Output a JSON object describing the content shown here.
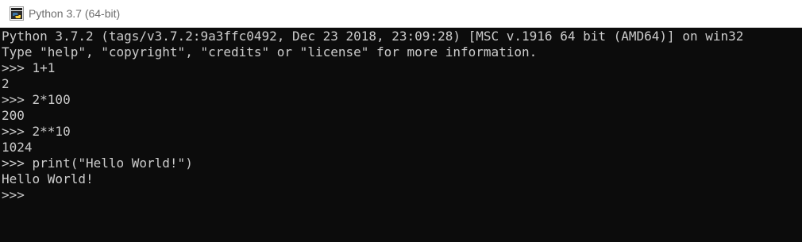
{
  "window": {
    "title": "Python 3.7 (64-bit)",
    "icon": "python-icon"
  },
  "console": {
    "prompt": ">>> ",
    "lines": [
      {
        "type": "output",
        "text": "Python 3.7.2 (tags/v3.7.2:9a3ffc0492, Dec 23 2018, 23:09:28) [MSC v.1916 64 bit (AMD64)] on win32"
      },
      {
        "type": "output",
        "text": "Type \"help\", \"copyright\", \"credits\" or \"license\" for more information."
      },
      {
        "type": "input",
        "text": "1+1"
      },
      {
        "type": "output",
        "text": "2"
      },
      {
        "type": "input",
        "text": "2*100"
      },
      {
        "type": "output",
        "text": "200"
      },
      {
        "type": "input",
        "text": "2**10"
      },
      {
        "type": "output",
        "text": "1024"
      },
      {
        "type": "input",
        "text": "print(\"Hello World!\")"
      },
      {
        "type": "output",
        "text": "Hello World!"
      },
      {
        "type": "input",
        "text": ""
      }
    ]
  },
  "colors": {
    "background": "#0c0c0c",
    "text": "#cccccc",
    "titlebar": "#ffffff",
    "title_text": "#6e6e6e"
  }
}
